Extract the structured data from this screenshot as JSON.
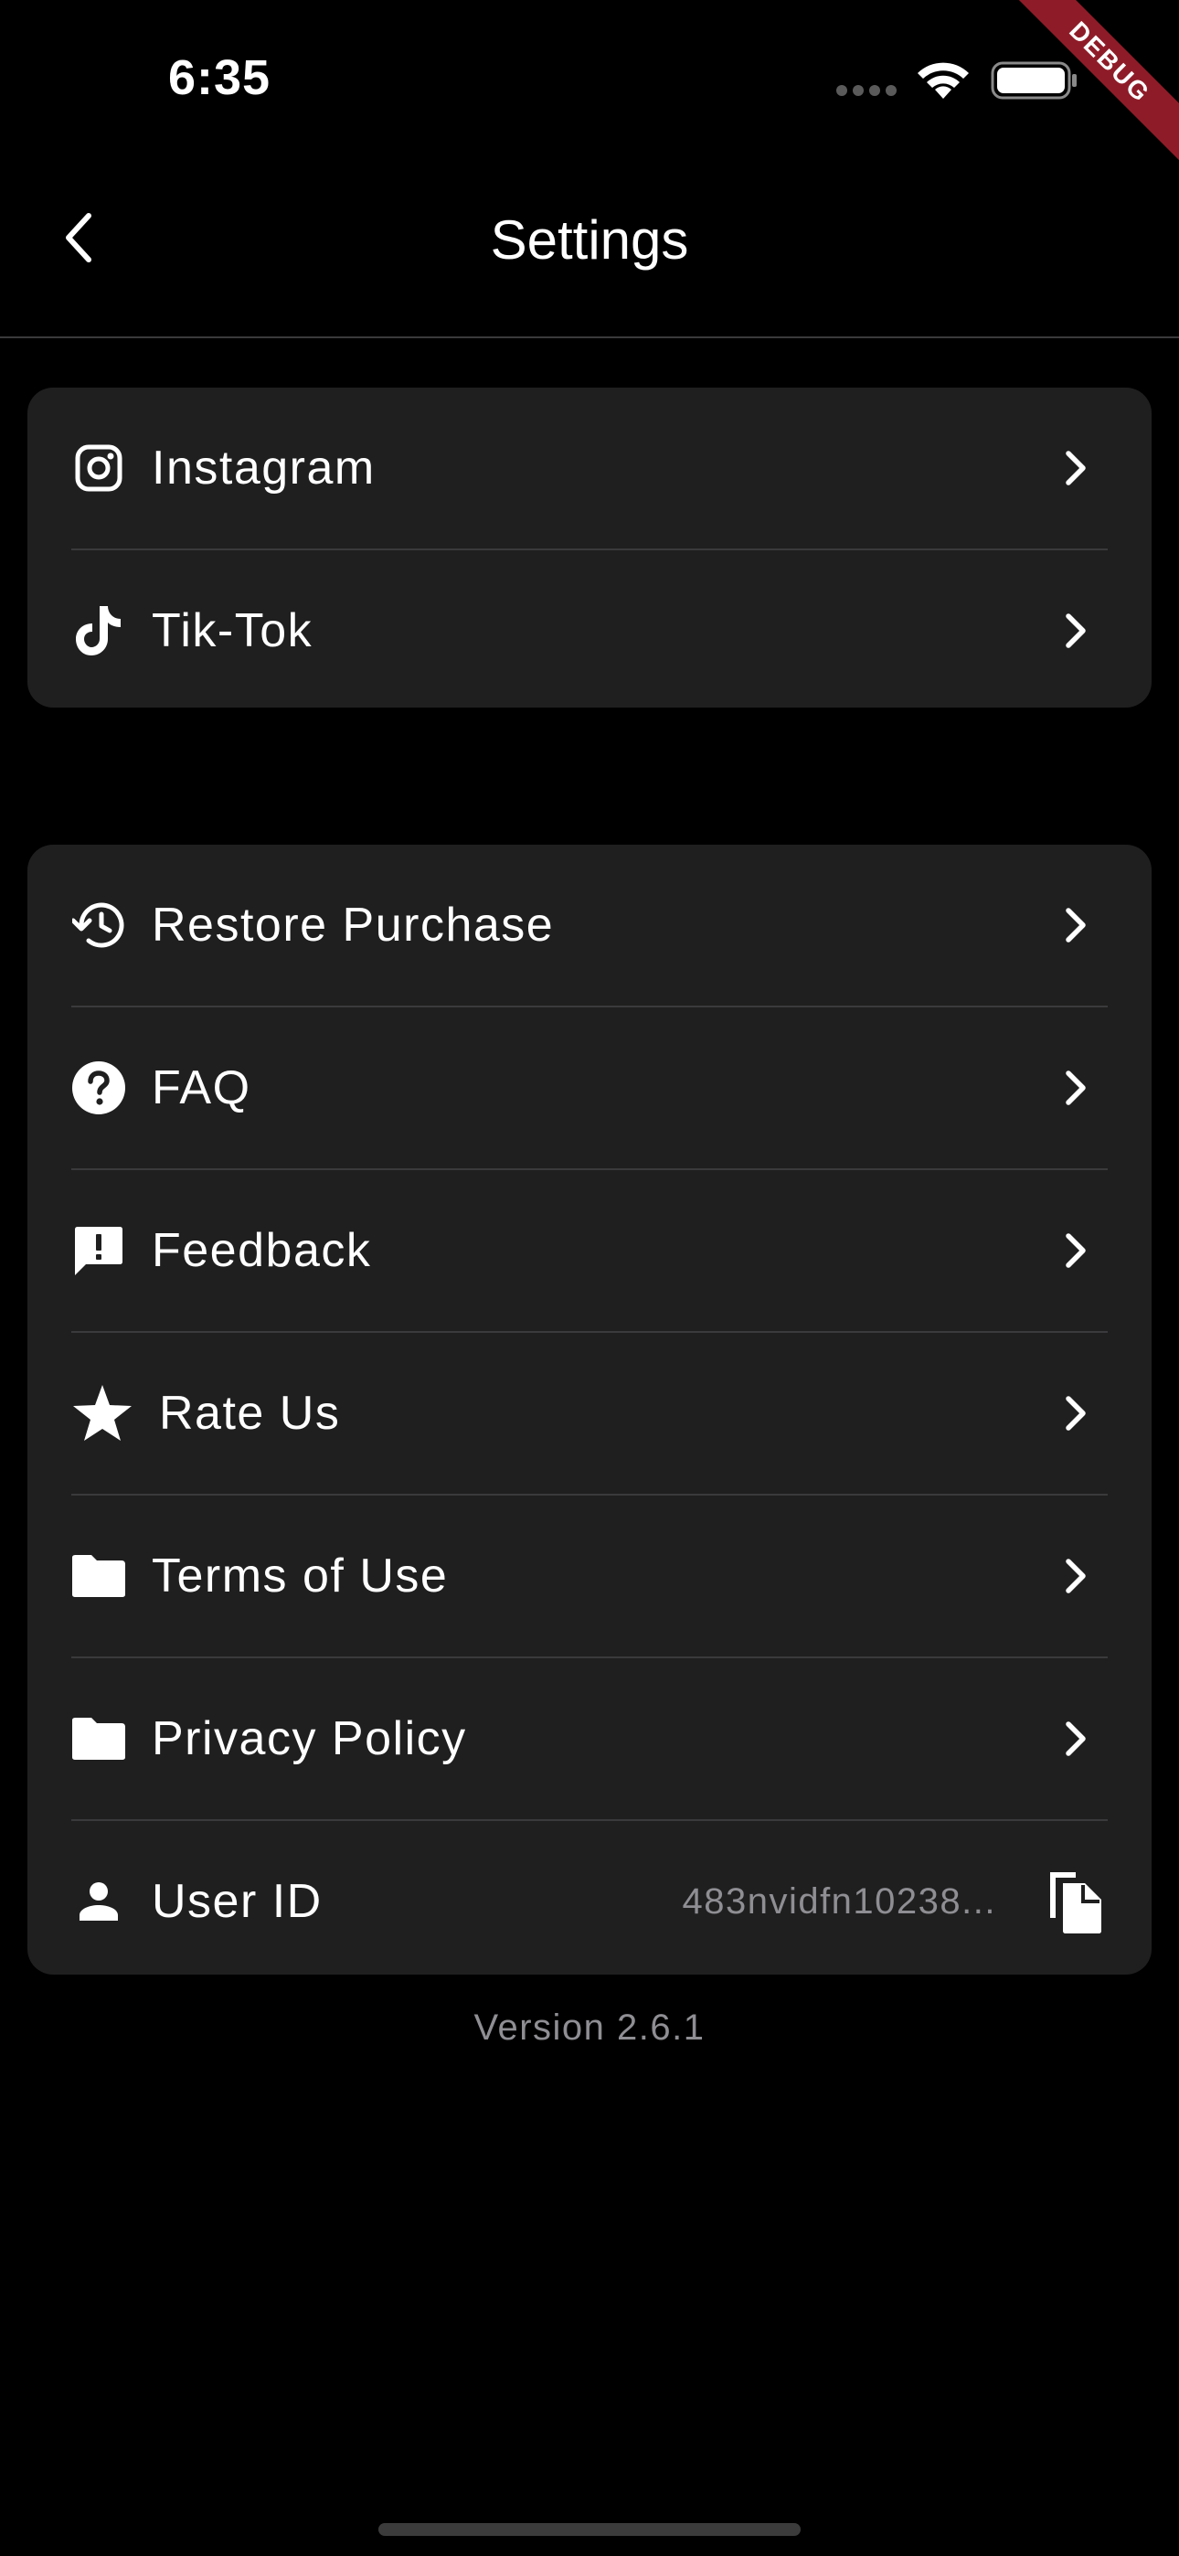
{
  "status_bar": {
    "time": "6:35",
    "debug_label": "DEBUG"
  },
  "nav": {
    "title": "Settings",
    "back_icon": "chevron-left-icon"
  },
  "social": {
    "items": [
      {
        "label": "Instagram",
        "icon": "instagram-icon"
      },
      {
        "label": "Tik-Tok",
        "icon": "tiktok-icon"
      }
    ]
  },
  "main": {
    "items": [
      {
        "label": "Restore Purchase",
        "icon": "history-icon"
      },
      {
        "label": "FAQ",
        "icon": "help-circle-icon"
      },
      {
        "label": "Feedback",
        "icon": "feedback-icon"
      },
      {
        "label": "Rate Us",
        "icon": "star-icon"
      },
      {
        "label": "Terms of Use",
        "icon": "folder-icon"
      },
      {
        "label": "Privacy Policy",
        "icon": "folder-icon"
      }
    ],
    "user_id": {
      "label": "User ID",
      "value": "483nvidfn10238...",
      "icon": "person-icon",
      "copy_icon": "copy-icon"
    }
  },
  "version": "Version 2.6.1",
  "colors": {
    "background": "#000000",
    "card": "#1f1f1f",
    "divider": "#3a3a3c",
    "secondary_text": "#8e8e93",
    "debug_banner": "#8e1c28"
  }
}
